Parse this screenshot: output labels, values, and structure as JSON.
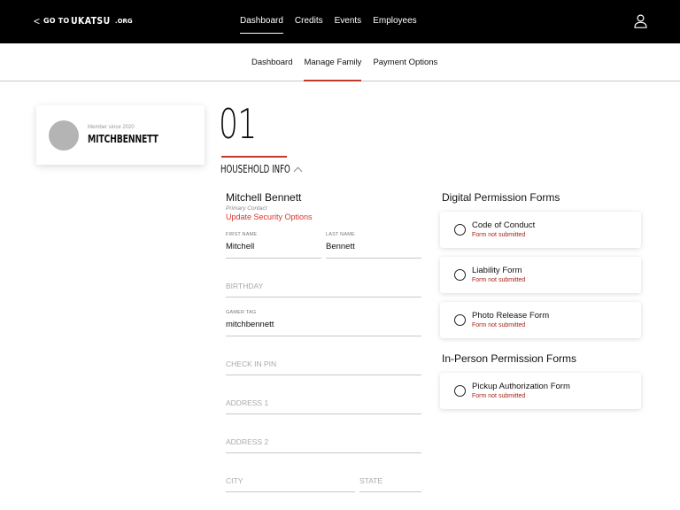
{
  "topbar": {
    "back_chevron": "<",
    "goto_text": "GO TO",
    "brand_text": "UKATSU",
    "brand_tld": ".ORG",
    "nav": [
      {
        "label": "Dashboard",
        "active": true
      },
      {
        "label": "Credits",
        "active": false
      },
      {
        "label": "Events",
        "active": false
      },
      {
        "label": "Employees",
        "active": false
      }
    ],
    "user_icon": "user-icon"
  },
  "subnav": {
    "items": [
      {
        "label": "Dashboard",
        "active": false
      },
      {
        "label": "Manage Family",
        "active": true
      },
      {
        "label": "Payment Options",
        "active": false
      }
    ],
    "accent_color": "#c0392b"
  },
  "profile": {
    "member_since": "Member since 2020",
    "name": "MITCHBENNETT"
  },
  "section": {
    "number": "01",
    "title": "HOUSEHOLD INFO",
    "toggle_icon": "chevron-up-icon"
  },
  "contact": {
    "name": "Mitchell Bennett",
    "role": "Primary Contact",
    "security_link": "Update Security Options"
  },
  "fields": {
    "first_name": {
      "label": "FIRST NAME",
      "value": "Mitchell"
    },
    "last_name": {
      "label": "LAST NAME",
      "value": "Bennett"
    },
    "birthday": {
      "placeholder": "BIRTHDAY"
    },
    "gamer_tag": {
      "label": "GAMER TAG",
      "value": "mitchbennett"
    },
    "check_in_pin": {
      "placeholder": "CHECK IN PIN"
    },
    "address_1": {
      "placeholder": "ADDRESS 1"
    },
    "address_2": {
      "placeholder": "ADDRESS 2"
    },
    "city": {
      "placeholder": "CITY"
    },
    "state": {
      "placeholder": "STATE"
    }
  },
  "digital_forms": {
    "heading": "Digital Permission Forms",
    "items": [
      {
        "name": "Code of Conduct",
        "status": "Form not submitted"
      },
      {
        "name": "Liability Form",
        "status": "Form not submitted"
      },
      {
        "name": "Photo Release Form",
        "status": "Form not submitted"
      }
    ]
  },
  "in_person_forms": {
    "heading": "In-Person Permission Forms",
    "items": [
      {
        "name": "Pickup Authorization Form",
        "status": "Form not submitted"
      }
    ]
  },
  "colors": {
    "topbar_bg": "#000000",
    "accent_red": "#c0392b",
    "status_red": "#a8231a"
  }
}
